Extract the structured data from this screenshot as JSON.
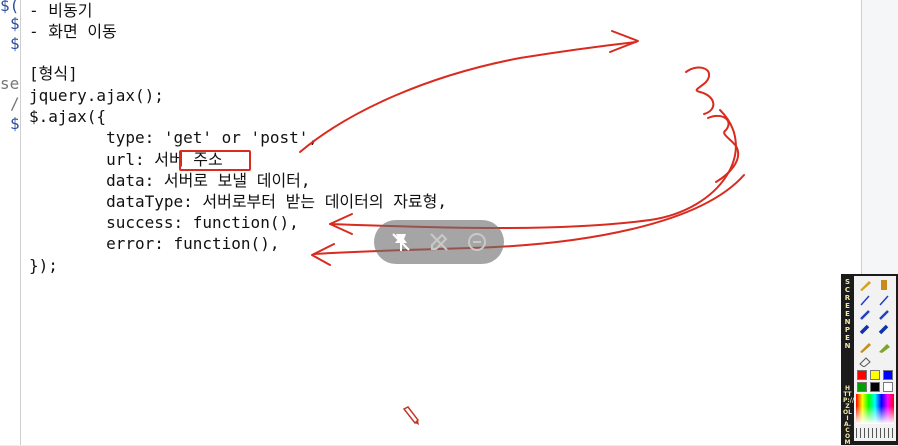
{
  "background_editor": {
    "fragments": [
      {
        "text": "$(",
        "color": "blue"
      },
      {
        "text": "$",
        "color": "blue"
      },
      {
        "text": "$",
        "color": "blue"
      },
      {
        "text": "se",
        "color": "gray"
      },
      {
        "text": "/",
        "color": "gray"
      },
      {
        "text": "$",
        "color": "blue"
      }
    ]
  },
  "note": {
    "lines": [
      "- 비동기",
      "- 화면 이동",
      "",
      "[형식]",
      "jquery.ajax();",
      "$.ajax({",
      "        type: 'get' or 'post',",
      "        url: 서버 주소",
      "        data: 서버로 보낼 데이터,",
      "        dataType: 서버로부터 받는 데이터의 자료형,",
      "        success: function(),",
      "        error: function(),",
      "});"
    ]
  },
  "overlay": {
    "buttons": [
      {
        "icon": "pin-off-icon"
      },
      {
        "icon": "pen-off-icon"
      },
      {
        "icon": "minus-circle-icon"
      }
    ]
  },
  "pen_toolbar": {
    "label": "SCREEN PEN",
    "url": "HTTP://ZOLIA.COM",
    "colors": [
      "#ff0000",
      "#ffff00",
      "#0000ff",
      "#00a000",
      "#000000",
      "#ffffff"
    ],
    "accent": "#d92b1f"
  }
}
